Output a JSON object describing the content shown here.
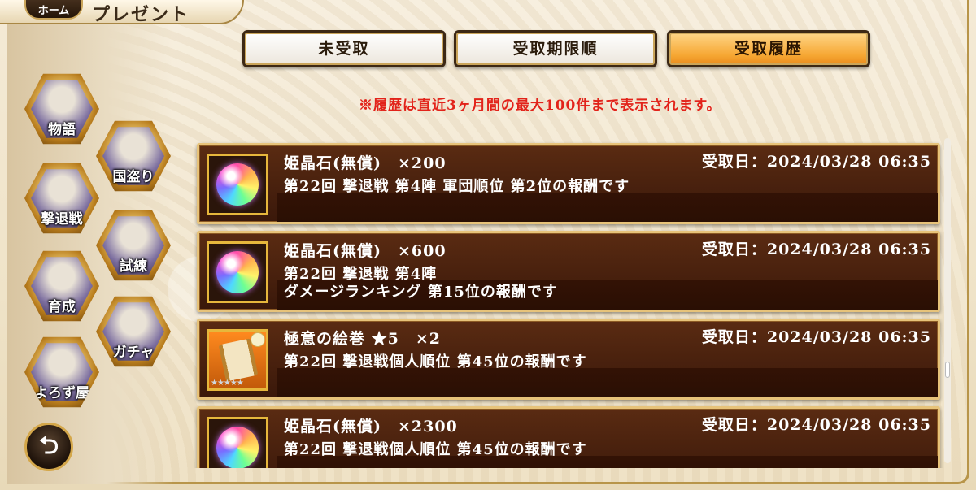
{
  "header": {
    "home_label": "ホーム",
    "title": "プレゼント"
  },
  "tabs": [
    {
      "label": "未受取",
      "active": false
    },
    {
      "label": "受取期限順",
      "active": false
    },
    {
      "label": "受取履歴",
      "active": true
    }
  ],
  "notice": "※履歴は直近3ヶ月間の最大100件まで表示されます。",
  "side_menu": [
    {
      "label": "物語"
    },
    {
      "label": "国盗り"
    },
    {
      "label": "撃退戦"
    },
    {
      "label": "試練"
    },
    {
      "label": "育成"
    },
    {
      "label": "ガチャ"
    },
    {
      "label": "よろず屋"
    }
  ],
  "items": [
    {
      "icon": "rainbow-orb-icon",
      "name": "姫晶石(無償)　×200",
      "date": "受取日：2024/03/28 06:35",
      "desc": "第22回 撃退戦 第4陣 軍団順位 第2位の報酬です"
    },
    {
      "icon": "rainbow-orb-icon",
      "name": "姫晶石(無償)　×600",
      "date": "受取日：2024/03/28 06:35",
      "desc": "第22回 撃退戦 第4陣\nダメージランキング 第15位の報酬です"
    },
    {
      "icon": "scroll-icon",
      "name": " 極意の絵巻 ★5　×2",
      "date": "受取日：2024/03/28 06:35",
      "desc": "第22回 撃退戦個人順位 第45位の報酬です",
      "stars": "★★★★★"
    },
    {
      "icon": "rainbow-orb-icon",
      "name": "姫晶石(無償)　×2300",
      "date": "受取日：2024/03/28 06:35",
      "desc": "第22回 撃退戦個人順位 第45位の報酬です"
    }
  ],
  "back_button_glyph": "⮌"
}
